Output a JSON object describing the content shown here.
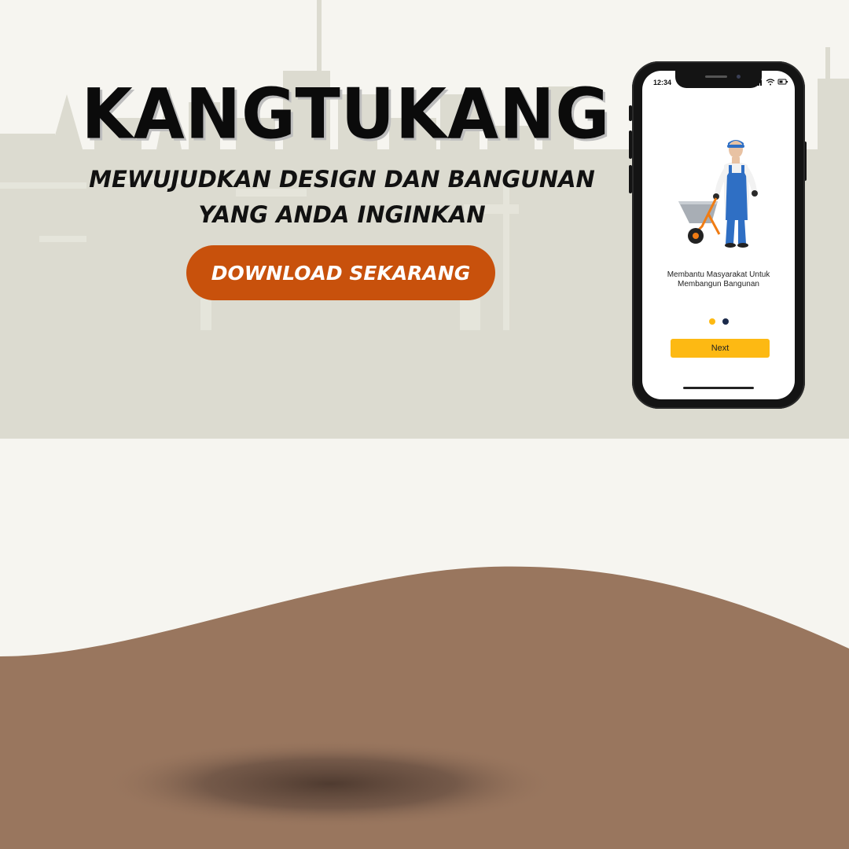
{
  "banner": {
    "title": "KANGTUKANG",
    "tagline_line1": "MEWUJUDKAN DESIGN DAN BANGUNAN",
    "tagline_line2": "YANG ANDA INGINKAN",
    "cta_label": "DOWNLOAD SEKARANG"
  },
  "phone": {
    "status_time": "12:34",
    "onboarding_line1": "Membantu Masyarakat Untuk",
    "onboarding_line2": "Membangun Bangunan",
    "next_label": "Next",
    "pager": {
      "total": 2,
      "active": 1
    }
  },
  "colors": {
    "background": "#f6f5f0",
    "skyline": "#dcdbd0",
    "ground": "#99765e",
    "cta": "#c8510c",
    "next_button": "#fdb913",
    "dot_active": "#fdb913",
    "dot_inactive": "#1b2a4a"
  }
}
